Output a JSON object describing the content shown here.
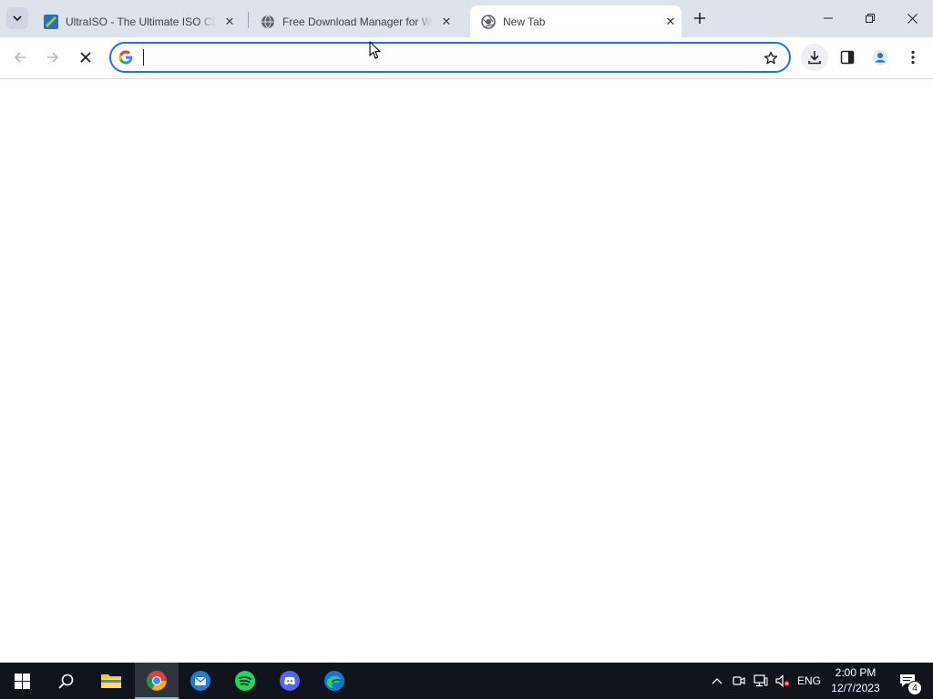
{
  "tabs": [
    {
      "title": "UltraISO - The Ultimate ISO CD",
      "icon": "ultraiso-icon"
    },
    {
      "title": "Free Download Manager for Windows",
      "icon": "globe-icon"
    },
    {
      "title": "New Tab",
      "icon": "chrome-newtab-icon",
      "active": true
    }
  ],
  "omnibox": {
    "value": "",
    "placeholder": ""
  },
  "taskbar": {
    "apps": [
      "start",
      "search",
      "file-explorer",
      "chrome",
      "thunderbird",
      "spotify",
      "discord",
      "edge"
    ],
    "language": "ENG",
    "time": "2:00 PM",
    "date": "12/7/2023",
    "notification_count": "4"
  },
  "colors": {
    "accent": "#1a73e8",
    "tabstrip": "#dee3eb",
    "taskbar": "#10141c"
  }
}
